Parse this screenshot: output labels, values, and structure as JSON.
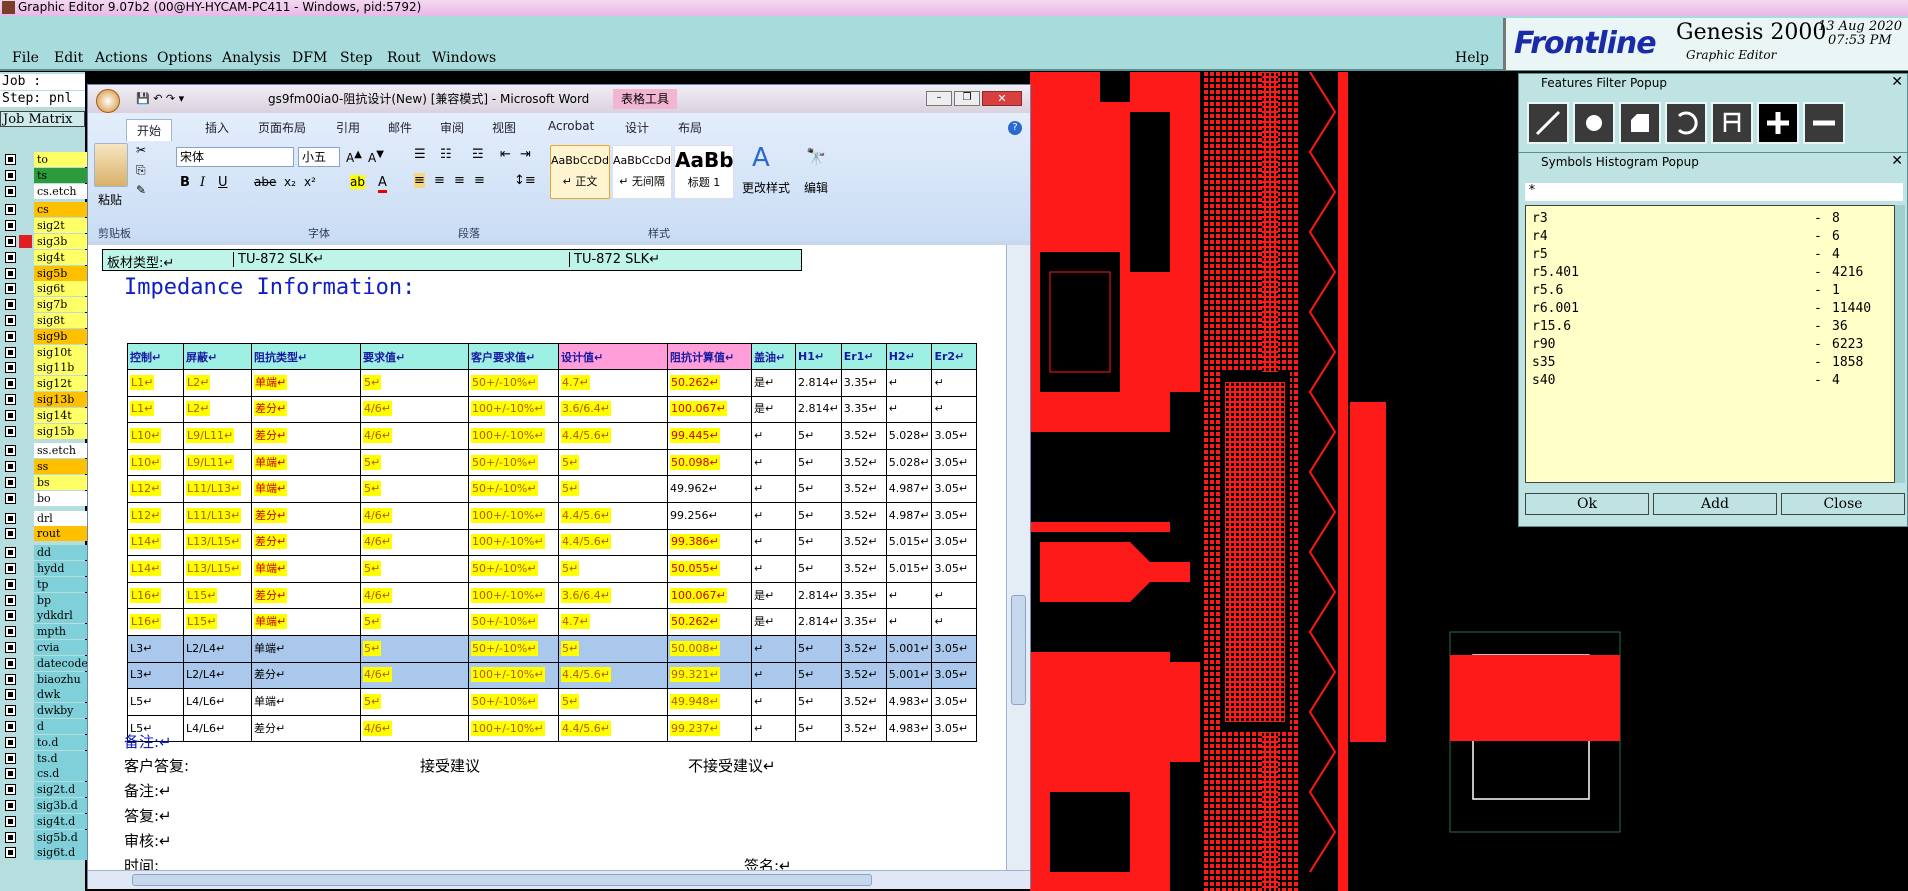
{
  "app_title": "Graphic Editor 9.07b2 (00@HY-HYCAM-PC411 - Windows, pid:5792)",
  "menu": [
    "File",
    "Edit",
    "Actions",
    "Options",
    "Analysis",
    "DFM",
    "Step",
    "Rout",
    "Windows"
  ],
  "help": "Help",
  "brand": {
    "logo": "Frontline",
    "product": "Genesis 2000",
    "sub": "Graphic Editor",
    "date": "13 Aug 2020",
    "time": "07:53 PM"
  },
  "left_panel": {
    "job": "Job : gs9fm00ia0",
    "step": "Step: pnl",
    "matrix": "Job Matrix",
    "layers": [
      "to",
      "ts",
      "cs.etch",
      "cs",
      "sig2t",
      "sig3b",
      "sig4t",
      "sig5b",
      "sig6t",
      "sig7b",
      "sig8t",
      "sig9b",
      "sig10t",
      "sig11b",
      "sig12t",
      "sig13b",
      "sig14t",
      "sig15b",
      "ss.etch",
      "ss",
      "bs",
      "bo",
      "drl",
      "rout",
      "dd",
      "hydd",
      "tp",
      "bp",
      "ydkdrl",
      "mpth",
      "cvia",
      "datecode",
      "biaozhu",
      "dwk",
      "dwkby",
      "d",
      "to.d",
      "ts.d",
      "cs.d",
      "sig2t.d",
      "sig3b.d",
      "sig4t.d",
      "sig5b.d",
      "sig6t.d"
    ]
  },
  "word": {
    "title": "gs9fm00ia0-阻抗设计(New) [兼容模式] - Microsoft Word",
    "context_tab": "表格工具",
    "tabs": [
      "开始",
      "插入",
      "页面布局",
      "引用",
      "邮件",
      "审阅",
      "视图",
      "Acrobat",
      "设计",
      "布局"
    ],
    "font_name": "宋体",
    "font_size": "小五",
    "groups": {
      "clipboard": "剪贴板",
      "font": "字体",
      "paragraph": "段落",
      "styles": "样式"
    },
    "paste": "粘贴",
    "styles": [
      {
        "sample": "AaBbCcDd",
        "name": "↵ 正文"
      },
      {
        "sample": "AaBbCcDd",
        "name": "↵ 无间隔"
      },
      {
        "sample": "AaBb",
        "name": "标题 1"
      }
    ],
    "change_styles": "更改样式",
    "edit": "编辑",
    "material_label": "板材类型:↵",
    "material_value1": "TU-872 SLK↵",
    "material_value2": "TU-872 SLK↵",
    "heading": "Impedance Information:",
    "table_headers": [
      "控制↵",
      "屏蔽↵",
      "阻抗类型↵",
      "要求值↵",
      "客户要求值↵",
      "设计值↵",
      "阻抗计算值↵",
      "盖油↵",
      "H1↵",
      "Er1↵",
      "H2↵",
      "Er2↵"
    ],
    "rows": [
      [
        "L1↵",
        "L2↵",
        "单端↵",
        "5↵",
        "50+/-10%↵",
        "4.7↵",
        "50.262↵",
        "是↵",
        "2.814↵",
        "3.35↵",
        "↵",
        "↵"
      ],
      [
        "L1↵",
        "L2↵",
        "差分↵",
        "4/6↵",
        "100+/-10%↵",
        "3.6/6.4↵",
        "100.067↵",
        "是↵",
        "2.814↵",
        "3.35↵",
        "↵",
        "↵"
      ],
      [
        "L10↵",
        "L9/L11↵",
        "差分↵",
        "4/6↵",
        "100+/-10%↵",
        "4.4/5.6↵",
        "99.445↵",
        "↵",
        "5↵",
        "3.52↵",
        "5.028↵",
        "3.05↵"
      ],
      [
        "L10↵",
        "L9/L11↵",
        "单端↵",
        "5↵",
        "50+/-10%↵",
        "5↵",
        "50.098↵",
        "↵",
        "5↵",
        "3.52↵",
        "5.028↵",
        "3.05↵"
      ],
      [
        "L12↵",
        "L11/L13↵",
        "单端↵",
        "5↵",
        "50+/-10%↵",
        "5↵",
        "49.962↵",
        "↵",
        "5↵",
        "3.52↵",
        "4.987↵",
        "3.05↵"
      ],
      [
        "L12↵",
        "L11/L13↵",
        "差分↵",
        "4/6↵",
        "100+/-10%↵",
        "4.4/5.6↵",
        "99.256↵",
        "↵",
        "5↵",
        "3.52↵",
        "4.987↵",
        "3.05↵"
      ],
      [
        "L14↵",
        "L13/L15↵",
        "差分↵",
        "4/6↵",
        "100+/-10%↵",
        "4.4/5.6↵",
        "99.386↵",
        "↵",
        "5↵",
        "3.52↵",
        "5.015↵",
        "3.05↵"
      ],
      [
        "L14↵",
        "L13/L15↵",
        "单端↵",
        "5↵",
        "50+/-10%↵",
        "5↵",
        "50.055↵",
        "↵",
        "5↵",
        "3.52↵",
        "5.015↵",
        "3.05↵"
      ],
      [
        "L16↵",
        "L15↵",
        "差分↵",
        "4/6↵",
        "100+/-10%↵",
        "3.6/6.4↵",
        "100.067↵",
        "是↵",
        "2.814↵",
        "3.35↵",
        "↵",
        "↵"
      ],
      [
        "L16↵",
        "L15↵",
        "单端↵",
        "5↵",
        "50+/-10%↵",
        "4.7↵",
        "50.262↵",
        "是↵",
        "2.814↵",
        "3.35↵",
        "↵",
        "↵"
      ],
      [
        "L3↵",
        "L2/L4↵",
        "单端↵",
        "5↵",
        "50+/-10%↵",
        "5↵",
        "50.008↵",
        "↵",
        "5↵",
        "3.52↵",
        "5.001↵",
        "3.05↵"
      ],
      [
        "L3↵",
        "L2/L4↵",
        "差分↵",
        "4/6↵",
        "100+/-10%↵",
        "4.4/5.6↵",
        "99.321↵",
        "↵",
        "5↵",
        "3.52↵",
        "5.001↵",
        "3.05↵"
      ],
      [
        "L5↵",
        "L4/L6↵",
        "单端↵",
        "5↵",
        "50+/-10%↵",
        "5↵",
        "49.948↵",
        "↵",
        "5↵",
        "3.52↵",
        "4.983↵",
        "3.05↵"
      ],
      [
        "L5↵",
        "L4/L6↵",
        "差分↵",
        "4/6↵",
        "100+/-10%↵",
        "4.4/5.6↵",
        "99.237↵",
        "↵",
        "5↵",
        "3.52↵",
        "4.983↵",
        "3.05↵"
      ]
    ],
    "notes": {
      "remark1": "备注:↵",
      "customer_reply": "客户答复:",
      "accept": "接受建议",
      "reject": "不接受建议↵",
      "remark2": "备注:↵",
      "reply": "答复:↵",
      "review": "审核:↵",
      "time": "时间:",
      "sign": "签名:↵"
    }
  },
  "features_filter": {
    "title": "Features Filter Popup"
  },
  "histogram": {
    "title": "Symbols Histogram Popup",
    "filter": "*",
    "items": [
      {
        "sym": "r3",
        "count": "8"
      },
      {
        "sym": "r4",
        "count": "6"
      },
      {
        "sym": "r5",
        "count": "4"
      },
      {
        "sym": "r5.401",
        "count": "4216"
      },
      {
        "sym": "r5.6",
        "count": "1"
      },
      {
        "sym": "r6.001",
        "count": "11440"
      },
      {
        "sym": "r15.6",
        "count": "36"
      },
      {
        "sym": "r90",
        "count": "6223"
      },
      {
        "sym": "s35",
        "count": "1858"
      },
      {
        "sym": "s40",
        "count": "4"
      }
    ],
    "buttons": {
      "ok": "Ok",
      "add": "Add",
      "close": "Close"
    }
  },
  "colors": {
    "cad_red": "#ff1a1a",
    "teal": "#a8dcdc",
    "highlight": "#ffff00",
    "layer_board": "#ffc000",
    "layer_signal": "#ffff66"
  }
}
